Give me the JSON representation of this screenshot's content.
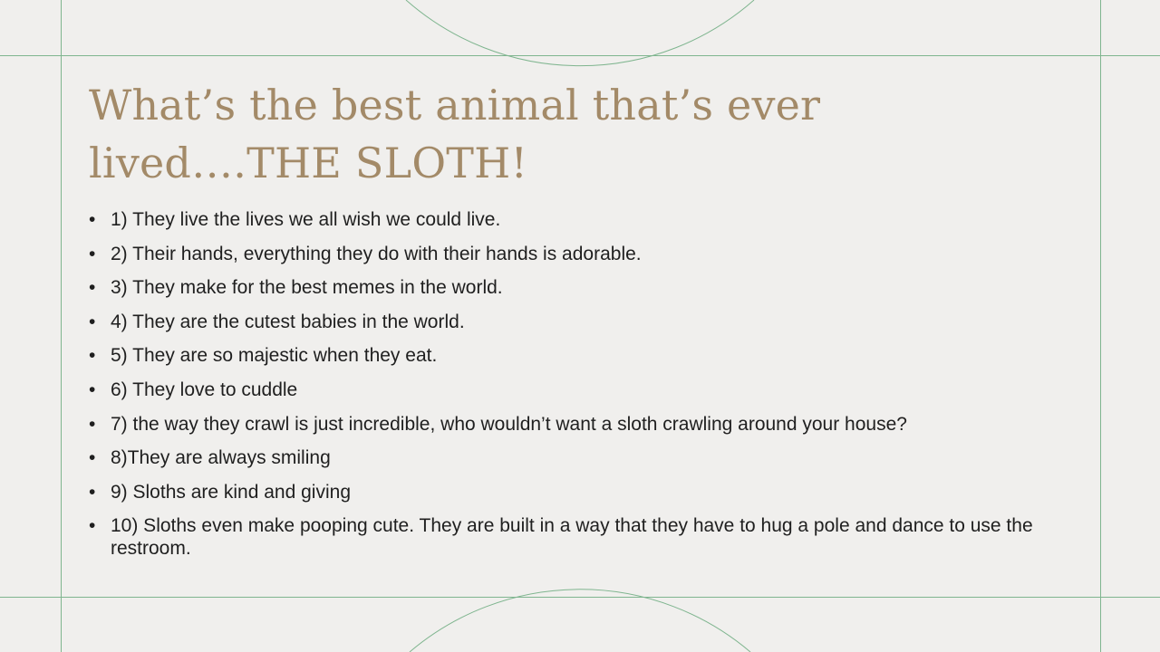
{
  "slide": {
    "title": "What’s the best animal that’s ever lived….THE SLOTH!",
    "bullet_symbol": "•",
    "items": [
      "1) They live the lives we all wish we could live.",
      "2) Their hands, everything they do with their hands is adorable.",
      "3) They make for the best memes in the world.",
      "4) They are the cutest babies in the world.",
      "5) They are so majestic when they eat.",
      "6) They love to cuddle",
      "7) the way they crawl is just incredible, who wouldn’t want a sloth crawling around your house?",
      "8)They are always smiling",
      "9) Sloths are kind and giving",
      "10)  Sloths even make pooping cute. They are built in a way that they have to hug a pole and dance to use the restroom."
    ]
  },
  "colors": {
    "background": "#f0efed",
    "title": "#a38a68",
    "body_text": "#1f1f1f",
    "decor_lines": "#7fb58f"
  }
}
